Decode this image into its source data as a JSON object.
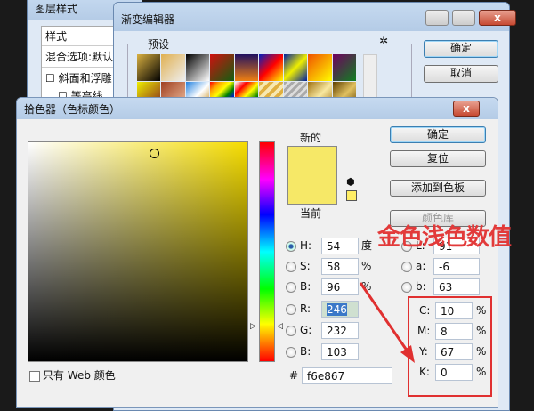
{
  "layer_style": {
    "title": "图层样式",
    "header": "样式",
    "items": [
      "混合选项:默认",
      "斜面和浮雕",
      "等高线"
    ]
  },
  "gradient_editor": {
    "title": "渐变编辑器",
    "presets_label": "预设",
    "ok": "确定",
    "cancel": "取消"
  },
  "color_picker": {
    "title": "拾色器（色标颜色）",
    "new_label": "新的",
    "current_label": "当前",
    "buttons": {
      "ok": "确定",
      "reset": "复位",
      "add_swatch": "添加到色板",
      "color_libraries": "颜色库"
    },
    "hsb": [
      {
        "label": "H:",
        "value": "54",
        "unit": "度"
      },
      {
        "label": "S:",
        "value": "58",
        "unit": "%"
      },
      {
        "label": "B:",
        "value": "96",
        "unit": "%"
      }
    ],
    "rgb": [
      {
        "label": "R:",
        "value": "246"
      },
      {
        "label": "G:",
        "value": "232"
      },
      {
        "label": "B:",
        "value": "103"
      }
    ],
    "lab": [
      {
        "label": "L:",
        "value": "91"
      },
      {
        "label": "a:",
        "value": "-6"
      },
      {
        "label": "b:",
        "value": "63"
      }
    ],
    "cmyk": [
      {
        "label": "C:",
        "value": "10",
        "unit": "%"
      },
      {
        "label": "M:",
        "value": "8",
        "unit": "%"
      },
      {
        "label": "Y:",
        "value": "67",
        "unit": "%"
      },
      {
        "label": "K:",
        "value": "0",
        "unit": "%"
      }
    ],
    "hex_label": "#",
    "hex": "f6e867",
    "web_only": "只有 Web 颜色",
    "color": "#f6e867"
  },
  "annotation": "金色浅色数值",
  "close_glyph": "x"
}
